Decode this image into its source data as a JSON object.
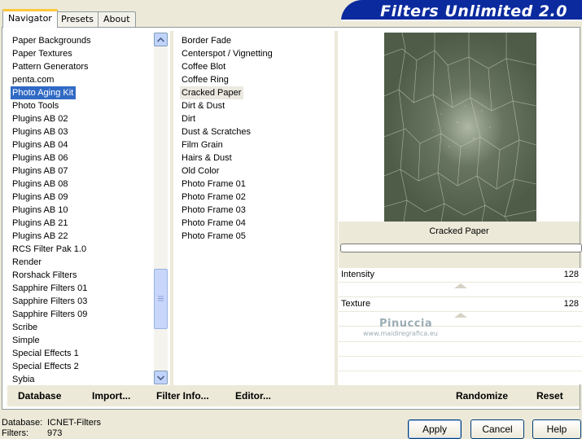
{
  "tabs": [
    {
      "label": "Navigator",
      "active": true
    },
    {
      "label": "Presets",
      "active": false
    },
    {
      "label": "About",
      "active": false
    }
  ],
  "app_title": "Filters Unlimited 2.0",
  "categories": [
    "Paper Backgrounds",
    "Paper Textures",
    "Pattern Generators",
    "penta.com",
    "Photo Aging Kit",
    "Photo Tools",
    "Plugins AB 02",
    "Plugins AB 03",
    "Plugins AB 04",
    "Plugins AB 06",
    "Plugins AB 07",
    "Plugins AB 08",
    "Plugins AB 09",
    "Plugins AB 10",
    "Plugins AB 21",
    "Plugins AB 22",
    "RCS Filter Pak 1.0",
    "Render",
    "Rorshack Filters",
    "Sapphire Filters 01",
    "Sapphire Filters 03",
    "Sapphire Filters 09",
    "Scribe",
    "Simple",
    "Special Effects 1",
    "Special Effects 2",
    "Sybia"
  ],
  "selected_category": "Photo Aging Kit",
  "filters": [
    "Border Fade",
    "Centerspot / Vignetting",
    "Coffee Blot",
    "Coffee Ring",
    "Cracked Paper",
    "Dirt & Dust",
    "Dirt",
    "Dust & Scratches",
    "Film Grain",
    "Hairs & Dust",
    "Old Color",
    "Photo Frame 01",
    "Photo Frame 02",
    "Photo Frame 03",
    "Photo Frame 04",
    "Photo Frame 05"
  ],
  "selected_filter": "Cracked Paper",
  "preview_caption": "Cracked Paper",
  "params": [
    {
      "label": "Intensity",
      "value": "128",
      "level": 128,
      "max": 255
    },
    {
      "label": "Texture",
      "value": "128",
      "level": 128,
      "max": 255
    }
  ],
  "watermark": {
    "title": "Pinuccia",
    "url": "www.maidiregrafica.eu"
  },
  "toolbar": {
    "database": "Database",
    "import": "Import...",
    "filter_info": "Filter Info...",
    "editor": "Editor...",
    "randomize": "Randomize",
    "reset": "Reset"
  },
  "status": {
    "database_label": "Database:",
    "database_value": "ICNET-Filters",
    "filters_label": "Filters:",
    "filters_value": "973"
  },
  "buttons": {
    "apply": "Apply",
    "cancel": "Cancel",
    "help": "Help"
  },
  "icons": {
    "scroll_up": "arrow-up-icon",
    "scroll_down": "arrow-down-icon",
    "thumb_grip": "grip-icon"
  }
}
